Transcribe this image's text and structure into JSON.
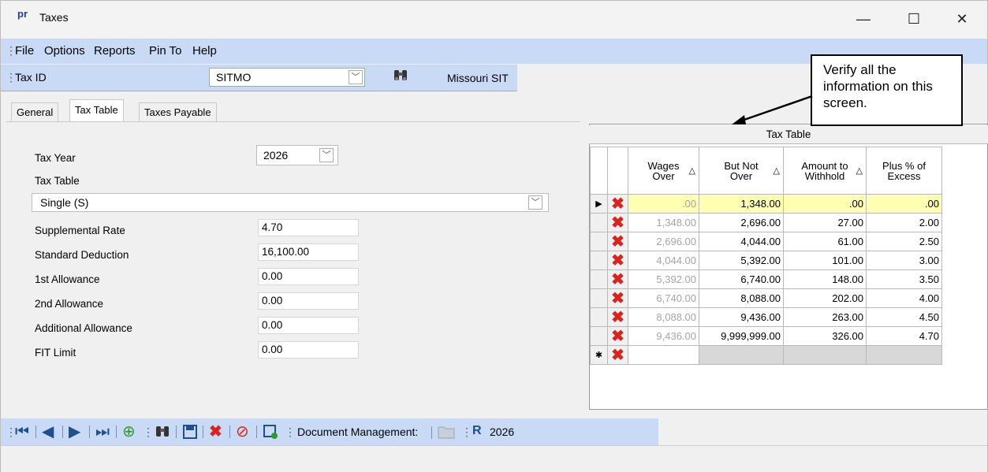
{
  "window": {
    "app_icon": "pr",
    "title": "Taxes",
    "minimize_glyph": "—",
    "maximize_glyph": "☐",
    "close_glyph": "✕"
  },
  "menu": [
    "File",
    "Options",
    "Reports",
    "Pin To",
    "Help"
  ],
  "taxid_bar": {
    "label": "Tax ID",
    "value": "SITMO",
    "description": "Missouri SIT",
    "find_icon": "binoculars-icon"
  },
  "tabs": [
    {
      "label": "General",
      "active": false
    },
    {
      "label": "Tax Table",
      "active": true
    },
    {
      "label": "Taxes Payable",
      "active": false
    }
  ],
  "form": {
    "tax_year_label": "Tax Year",
    "tax_year_value": "2026",
    "tax_table_label": "Tax Table",
    "tax_table_value": "Single (S)",
    "fields": [
      {
        "label": "Supplemental Rate",
        "value": "4.70"
      },
      {
        "label": "Standard Deduction",
        "value": "16,100.00"
      },
      {
        "label": "1st Allowance",
        "value": "0.00"
      },
      {
        "label": "2nd Allowance",
        "value": "0.00"
      },
      {
        "label": "Additional Allowance",
        "value": "0.00"
      },
      {
        "label": "FIT Limit",
        "value": "0.00"
      }
    ]
  },
  "grid": {
    "caption": "Tax Table",
    "columns": [
      {
        "line1": "Wages",
        "line2": "Over"
      },
      {
        "line1": "But Not",
        "line2": "Over"
      },
      {
        "line1": "Amount to",
        "line2": "Withhold"
      },
      {
        "line1": "Plus % of",
        "line2": "Excess"
      }
    ],
    "sort_glyph": "△",
    "current_row_glyph": "▶",
    "new_row_glyph": "✱",
    "delete_glyph": "✖",
    "rows": [
      [
        ".00",
        "1,348.00",
        ".00",
        ".00"
      ],
      [
        "1,348.00",
        "2,696.00",
        "27.00",
        "2.00"
      ],
      [
        "2,696.00",
        "4,044.00",
        "61.00",
        "2.50"
      ],
      [
        "4,044.00",
        "5,392.00",
        "101.00",
        "3.00"
      ],
      [
        "5,392.00",
        "6,740.00",
        "148.00",
        "3.50"
      ],
      [
        "6,740.00",
        "8,088.00",
        "202.00",
        "4.00"
      ],
      [
        "8,088.00",
        "9,436.00",
        "263.00",
        "4.50"
      ],
      [
        "9,436.00",
        "9,999,999.00",
        "326.00",
        "4.70"
      ]
    ]
  },
  "callout": {
    "text": "Verify all the information on this screen."
  },
  "bottom_toolbar": {
    "doc_mgmt_label": "Document Management:",
    "year": "2026",
    "icons": [
      "first-record-icon",
      "previous-record-icon",
      "next-record-icon",
      "last-record-icon",
      "add-icon",
      "find-icon",
      "save-icon",
      "delete-icon",
      "cancel-icon",
      "save-new-icon",
      "folder-icon",
      "report-icon"
    ]
  },
  "colors": {
    "toolbar_bg": "#c9daf7",
    "highlight_row": "#ffffb4",
    "delete_red": "#d9231f",
    "icon_blue": "#1f4f8f"
  }
}
